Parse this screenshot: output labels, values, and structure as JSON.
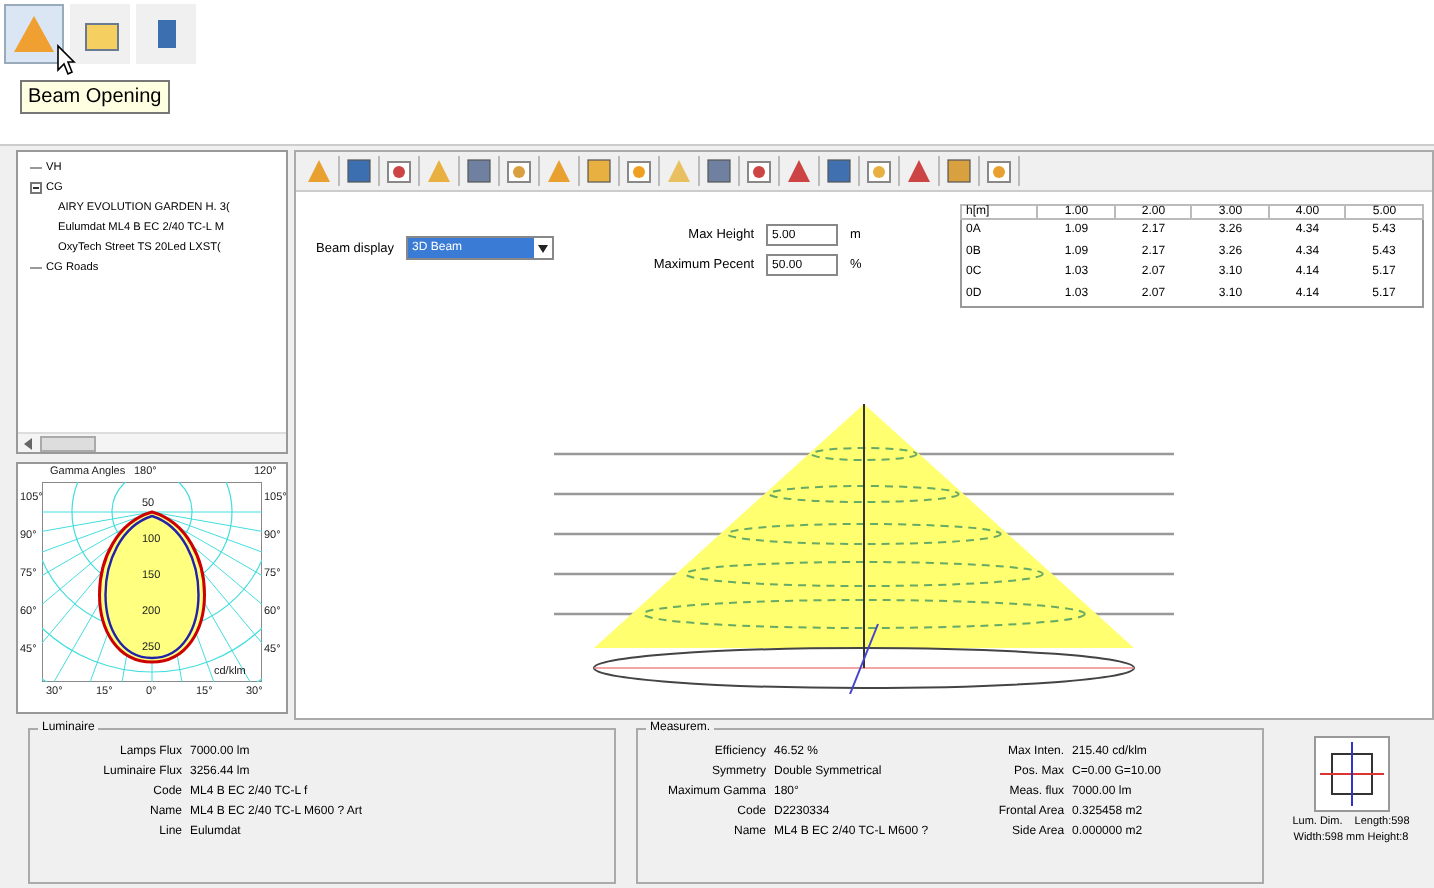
{
  "top_toolbar": {
    "tooltip": "Beam Opening"
  },
  "tree": {
    "items": [
      {
        "label": "VH",
        "expanded": false
      },
      {
        "label": "CG",
        "expanded": true,
        "children": [
          {
            "label": "AIRY EVOLUTION GARDEN H. 3("
          },
          {
            "label": "Eulumdat ML4 B EC 2/40 TC-L M"
          },
          {
            "label": "OxyTech Street TS 20Led LXST("
          }
        ]
      },
      {
        "label": "CG Roads",
        "expanded": false
      }
    ]
  },
  "polar": {
    "title": "Gamma Angles",
    "top_left": "180°",
    "top_right": "120°",
    "left_angles": [
      "105°",
      "90°",
      "75°",
      "60°",
      "45°"
    ],
    "right_angles": [
      "105°",
      "90°",
      "75°",
      "60°",
      "45°"
    ],
    "rings": [
      "50",
      "100",
      "150",
      "200",
      "250"
    ],
    "unit": "cd/klm",
    "bottom_angles": [
      "30°",
      "15°",
      "0°",
      "15°",
      "30°"
    ]
  },
  "controls": {
    "beam_display_label": "Beam display",
    "beam_display_value": "3D Beam",
    "max_height_label": "Max Height",
    "max_height_value": "5.00",
    "max_height_unit": "m",
    "max_percent_label": "Maximum Pecent",
    "max_percent_value": "50.00",
    "max_percent_unit": "%"
  },
  "beam_table": {
    "columns": [
      "h[m]",
      "1.00",
      "2.00",
      "3.00",
      "4.00",
      "5.00"
    ],
    "rows": [
      [
        "0A",
        "1.09",
        "2.17",
        "3.26",
        "4.34",
        "5.43"
      ],
      [
        "0B",
        "1.09",
        "2.17",
        "3.26",
        "4.34",
        "5.43"
      ],
      [
        "0C",
        "1.03",
        "2.07",
        "3.10",
        "4.14",
        "5.17"
      ],
      [
        "0D",
        "1.03",
        "2.07",
        "3.10",
        "4.14",
        "5.17"
      ]
    ]
  },
  "luminaire": {
    "title": "Luminaire",
    "fields": [
      {
        "label": "Lamps Flux",
        "value": "7000.00 lm"
      },
      {
        "label": "Luminaire Flux",
        "value": "3256.44 lm"
      },
      {
        "label": "Code",
        "value": "ML4 B EC 2/40 TC-L f"
      },
      {
        "label": "Name",
        "value": "ML4 B EC 2/40 TC-L  M600 ? Art"
      },
      {
        "label": "Line",
        "value": "Eulumdat"
      }
    ]
  },
  "measurement": {
    "title": "Measurem.",
    "left": [
      {
        "label": "Efficiency",
        "value": "46.52 %"
      },
      {
        "label": "Symmetry",
        "value": "Double Symmetrical"
      },
      {
        "label": "Maximum Gamma",
        "value": "180°"
      },
      {
        "label": "Code",
        "value": "D2230334"
      },
      {
        "label": "Name",
        "value": "ML4 B EC 2/40 TC-L  M600 ?"
      }
    ],
    "right": [
      {
        "label": "Max Inten.",
        "value": "215.40  cd/klm"
      },
      {
        "label": "Pos. Max",
        "value": "C=0.00 G=10.00"
      },
      {
        "label": "Meas. flux",
        "value": "7000.00 lm"
      },
      {
        "label": "Frontal Area",
        "value": "0.325458 m2"
      },
      {
        "label": "Side Area",
        "value": "0.000000 m2"
      }
    ]
  },
  "dimensions": {
    "label": "Lum. Dim.",
    "length": "Length:598",
    "size": "Width:598 mm Height:8"
  }
}
